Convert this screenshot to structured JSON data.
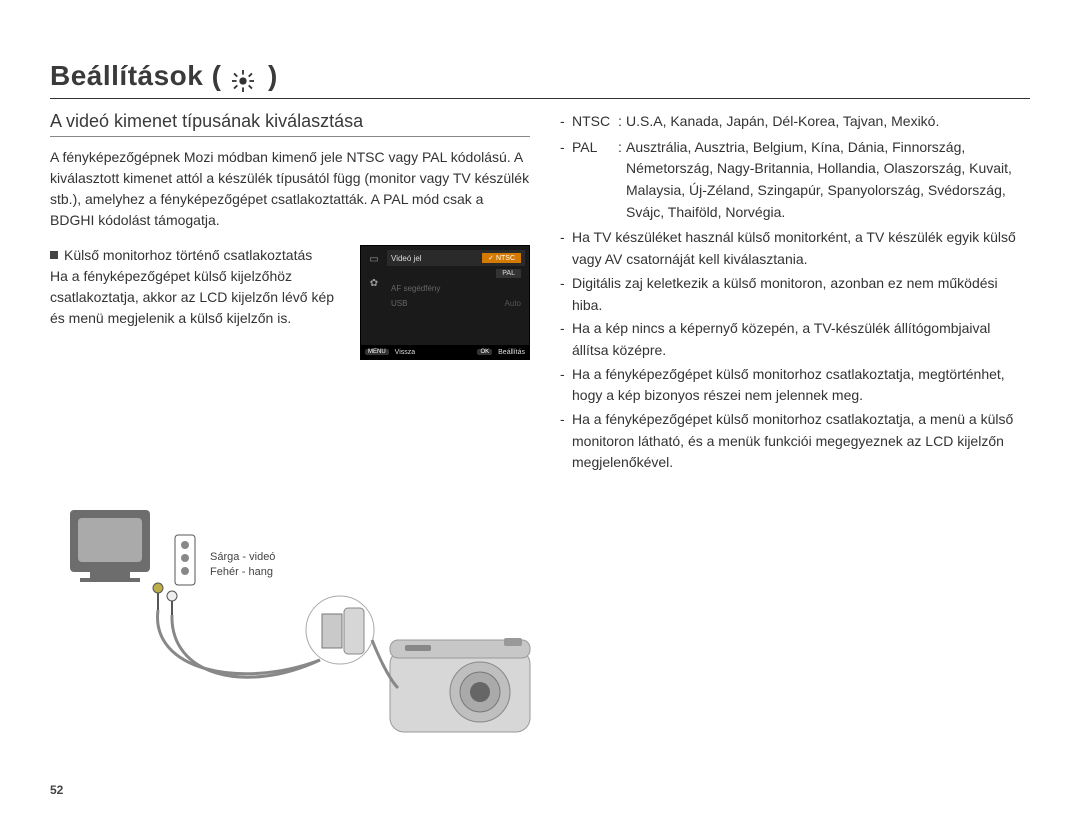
{
  "header": {
    "title_prefix": "Beállítások (",
    "title_suffix": ")"
  },
  "left": {
    "subheader": "A videó kimenet típusának kiválasztása",
    "intro": "A fényképezőgépnek Mozi módban kimenő jele NTSC vagy PAL kódolású. A kiválasztott kimenet attól a készülék típusától függ (monitor vagy TV készülék stb.), amelyhez a fényképezőgépet csatlakoztatták. A PAL mód csak a BDGHI kódolást támogatja.",
    "bullet_title": "Külső monitorhoz történő csatlakoztatás",
    "bullet_body": "Ha a fényképezőgépet külső kijelzőhöz csatlakoztatja, akkor az LCD kijelzőn lévő kép és menü megjelenik a külső kijelzőn is."
  },
  "menu": {
    "row1_label": "Videó jel",
    "row2_label": "AF segédfény",
    "row3_label": "USB",
    "opt_ntsc": "NTSC",
    "opt_pal": "PAL",
    "row3_val": "Auto",
    "footer_back_btn": "MENU",
    "footer_back": "Vissza",
    "footer_ok_btn": "OK",
    "footer_ok": "Beállítás"
  },
  "diagram": {
    "yellow": "Sárga - videó",
    "white": "Fehér - hang"
  },
  "right": {
    "ntsc_label": "NTSC",
    "ntsc_val": "U.S.A, Kanada, Japán, Dél-Korea, Tajvan, Mexikó.",
    "pal_label": "PAL",
    "pal_val": "Ausztrália, Ausztria, Belgium, Kína, Dánia, Finnország, Németország, Nagy-Britannia, Hollandia, Olaszország, Kuvait, Malaysia, Új-Zéland, Szingapúr, Spanyolország, Svédország, Svájc, Thaiföld, Norvégia.",
    "note1": "Ha TV készüléket használ külső monitorként, a TV készülék egyik külső vagy AV csatornáját kell kiválasztania.",
    "note2": "Digitális zaj keletkezik a külső monitoron, azonban ez nem működési hiba.",
    "note3": "Ha a kép nincs a képernyő közepén, a TV-készülék állítógombjaival állítsa középre.",
    "note4": "Ha a fényképezőgépet külső monitorhoz csatlakoztatja, megtörténhet, hogy a kép bizonyos részei nem jelennek meg.",
    "note5": "Ha a fényképezőgépet külső monitorhoz csatlakoztatja, a menü a külső monitoron látható, és a menük funkciói megegyeznek az LCD kijelzőn megjelenőkével."
  },
  "page_number": "52"
}
